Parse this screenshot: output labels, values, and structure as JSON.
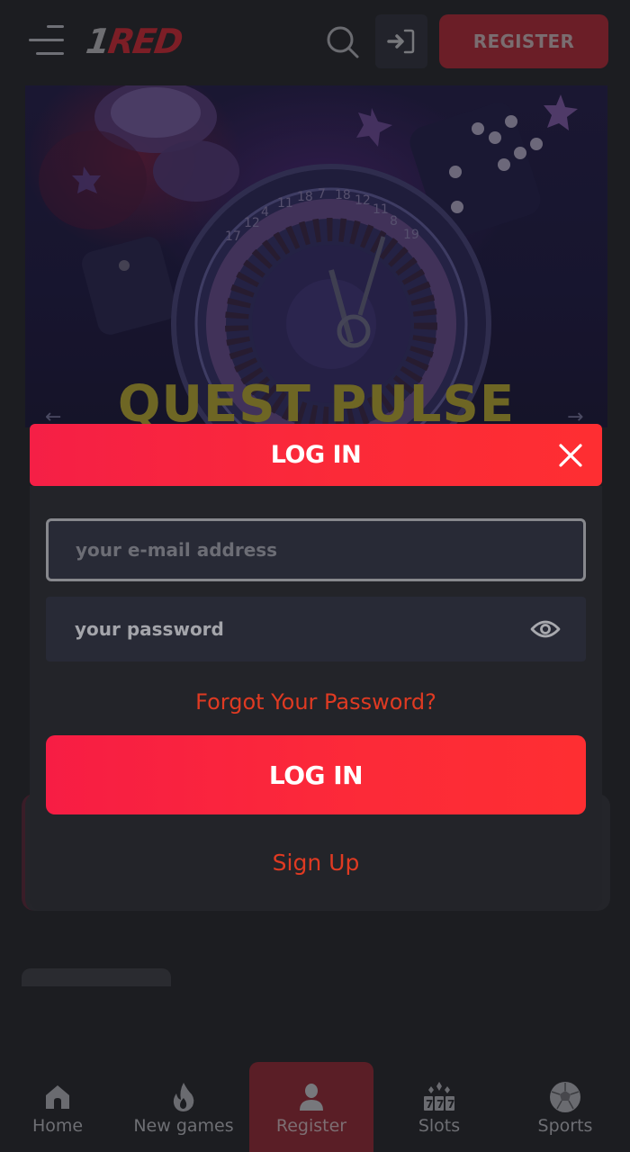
{
  "header": {
    "logo_prefix": "1",
    "logo_text": "RED",
    "register_label": "REGISTER",
    "icons": {
      "menu": "hamburger-icon",
      "search": "search-icon",
      "login": "sign-in-icon"
    }
  },
  "hero": {
    "title": "QUEST PULSE",
    "arrow_left": "←",
    "arrow_right": "→",
    "wheel_numbers": [
      "17",
      "12",
      "4",
      "11",
      "18",
      "7",
      "18",
      "12",
      "11",
      "8",
      "19"
    ]
  },
  "login_modal": {
    "title": "LOG IN",
    "close_icon": "close-icon",
    "email_placeholder": "your e-mail address",
    "email_value": "",
    "password_placeholder": "your password",
    "password_value": "",
    "show_password_icon": "eye-icon",
    "forgot_password": "Forgot Your Password?",
    "submit_label": "LOG IN",
    "signup_label": "Sign Up"
  },
  "bottom_nav": {
    "active": "Register",
    "items": [
      {
        "label": "Home",
        "icon": "home-icon"
      },
      {
        "label": "New games",
        "icon": "flame-icon"
      },
      {
        "label": "Register",
        "icon": "user-icon"
      },
      {
        "label": "Slots",
        "icon": "slot-machine-icon"
      },
      {
        "label": "Sports",
        "icon": "soccer-ball-icon"
      }
    ]
  },
  "colors": {
    "accent": "#fc2a38",
    "link": "#df3a22",
    "background": "#1c1d21",
    "modal_body": "#232429",
    "input_bg": "#282a36"
  }
}
